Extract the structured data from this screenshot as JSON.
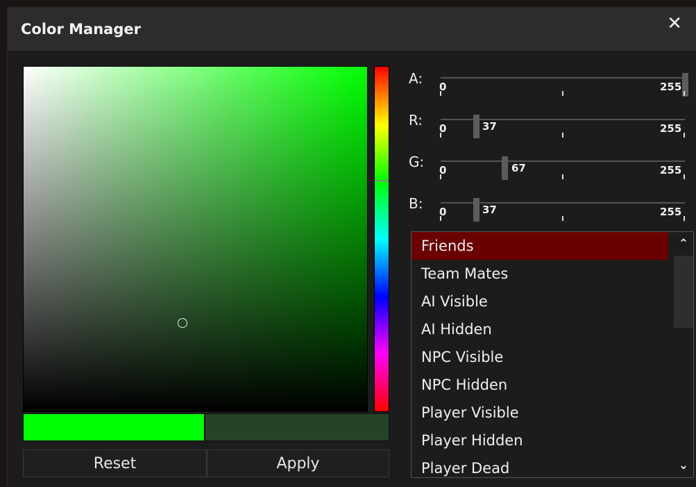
{
  "window": {
    "title": "Color Manager",
    "close_glyph": "✕"
  },
  "picker": {
    "hue_color": "#00ff00",
    "new_color": "#00ff00",
    "current_color": "#254325"
  },
  "sliders": [
    {
      "label": "A:",
      "min": "0",
      "max": "255",
      "value": 255,
      "value_text": ""
    },
    {
      "label": "R:",
      "min": "0",
      "max": "255",
      "value": 37,
      "value_text": "37"
    },
    {
      "label": "G:",
      "min": "0",
      "max": "255",
      "value": 67,
      "value_text": "67"
    },
    {
      "label": "B:",
      "min": "0",
      "max": "255",
      "value": 37,
      "value_text": "37"
    }
  ],
  "buttons": {
    "reset": "Reset",
    "apply": "Apply"
  },
  "list": {
    "items": [
      "Friends",
      "Team Mates",
      "AI Visible",
      "AI Hidden",
      "NPC Visible",
      "NPC Hidden",
      "Player Visible",
      "Player Hidden",
      "Player Dead"
    ],
    "selected_index": 0,
    "selected_color": "#6b0000",
    "scroll_up_glyph": "⌃",
    "scroll_down_glyph": "⌄"
  }
}
